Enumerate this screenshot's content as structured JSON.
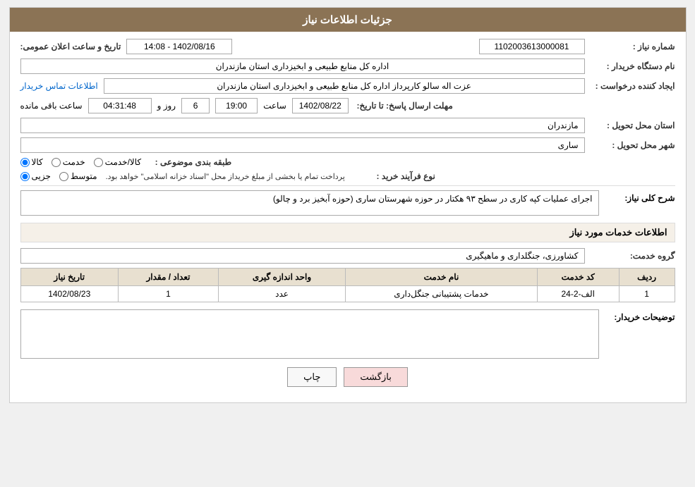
{
  "header": {
    "title": "جزئیات اطلاعات نیاز"
  },
  "fields": {
    "request_number_label": "شماره نیاز :",
    "request_number_value": "1102003613000081",
    "buyer_org_label": "نام دستگاه خریدار :",
    "buyer_org_value": "اداره کل منابع طبیعی و ابخیزداری استان مازندران",
    "creator_label": "ایجاد کننده درخواست :",
    "creator_value": "عزت اله سالو کارپرداز اداره کل منابع طبیعی و ابخیزداری استان مازندران",
    "contact_link": "اطلاعات تماس خریدار",
    "deadline_label": "مهلت ارسال پاسخ: تا تاریخ:",
    "announce_date_label": "تاریخ و ساعت اعلان عمومی:",
    "announce_date_value": "1402/08/16 - 14:08",
    "deadline_date": "1402/08/22",
    "deadline_time": "19:00",
    "deadline_days": "6",
    "deadline_remaining": "04:31:48",
    "deadline_remaining_label": "ساعت باقی مانده",
    "days_label": "روز و",
    "province_label": "استان محل تحویل :",
    "province_value": "مازندران",
    "city_label": "شهر محل تحویل :",
    "city_value": "ساری",
    "category_label": "طبقه بندی موضوعی :",
    "radio_goods": "کالا",
    "radio_service": "خدمت",
    "radio_goods_service": "کالا/خدمت",
    "purchase_type_label": "نوع فرآیند خرید :",
    "radio_partial": "جزیی",
    "radio_medium": "متوسط",
    "purchase_note": "پرداخت تمام یا بخشی از مبلغ خریداز محل \"اسناد خزانه اسلامی\" خواهد بود.",
    "description_label": "شرح کلی نیاز:",
    "description_value": "اجرای عملیات کپه کاری در سطح ۹۳ هکتار در حوزه شهرستان ساری (حوزه آبخیز برد و چالو)",
    "services_section": "اطلاعات خدمات مورد نیاز",
    "service_group_label": "گروه خدمت:",
    "service_group_value": "کشاورزی، جنگلداری و ماهیگیری",
    "table": {
      "headers": [
        "ردیف",
        "کد خدمت",
        "نام خدمت",
        "واحد اندازه گیری",
        "تعداد / مقدار",
        "تاریخ نیاز"
      ],
      "rows": [
        {
          "index": "1",
          "code": "الف-2-24",
          "name": "خدمات پشتیبانی جنگل‌داری",
          "unit": "عدد",
          "quantity": "1",
          "date": "1402/08/23"
        }
      ]
    },
    "buyer_notes_label": "توضیحات خریدار:",
    "buyer_notes_value": "",
    "btn_print": "چاپ",
    "btn_back": "بازگشت"
  }
}
